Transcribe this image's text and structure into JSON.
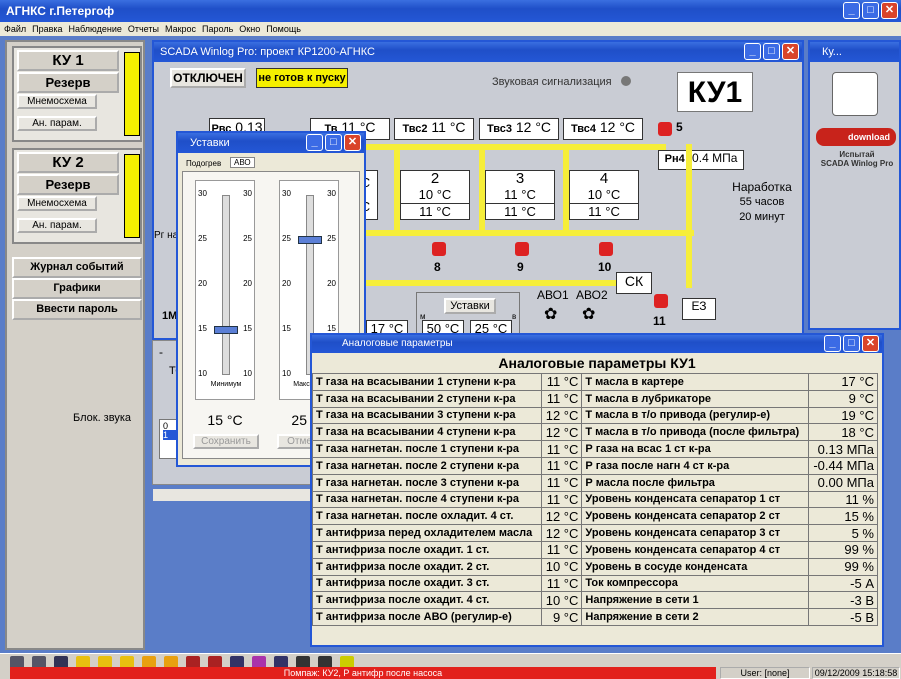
{
  "app_title": "АГНКС г.Петергоф",
  "menu": [
    "Файл",
    "Правка",
    "Наблюдение",
    "Отчеты",
    "Макрос",
    "Пароль",
    "Окно",
    "Помощь"
  ],
  "ku1": {
    "title": "КУ 1",
    "mode": "Резерв",
    "btn_mnemo": "Мнемосхема",
    "btn_an": "Ан. парам."
  },
  "ku2": {
    "title": "КУ 2",
    "mode": "Резерв",
    "btn_mnemo": "Мнемосхема",
    "btn_an": "Ан. парам."
  },
  "left_buttons": {
    "journal": "Журнал событий",
    "graphs": "Графики",
    "password": "Ввести пароль",
    "sound": "Блок. звука"
  },
  "scada": {
    "title": "SCADA Winlog Pro: проект КР1200-АГНКС",
    "status_off": "ОТКЛЮЧЕН",
    "status_ready": "не готов к пуску",
    "sound": "Звуковая сигнализация",
    "unit": "КУ1",
    "rvs_label": "Рвс",
    "rvs_value": "0.13 МПа",
    "tv_label": "Тв",
    "tv_value": "11 °С",
    "tvs2_label": "Твс2",
    "tvs2_value": "11 °С",
    "tvs3_label": "Твс3",
    "tvs3_value": "12 °С",
    "tvs4_label": "Твс4",
    "tvs4_value": "12 °С",
    "rn4_label": "Рн4",
    "rn4_value": "-0.4 МПа",
    "valve5": "5",
    "stages": [
      {
        "n": "2",
        "a": "10 °С",
        "b": "11 °С",
        "valve": "9"
      },
      {
        "n": "3",
        "a": "11 °С",
        "b": "11 °С",
        "valve": "9"
      },
      {
        "n": "4",
        "a": "10 °С",
        "b": "11 °С",
        "valve": "10"
      }
    ],
    "valve8": "8",
    "valve9": "9",
    "valve10": "10",
    "valve11": "11",
    "hours_label": "Наработка",
    "hours": "55 часов",
    "minutes": "20 минут",
    "sk": "СК",
    "e3": "ЕЗ",
    "avo1": "АВО1",
    "avo2": "АВО2",
    "ustavki": "Уставки",
    "m": "м",
    "v": "в",
    "t_m": "50 °С",
    "t_v": "25 °С",
    "t_left": "17 °С",
    "rg": "Рг на",
    "one_m": "1М",
    "to": "ТО",
    "c1": "С",
    "c2": "С",
    "minus": "-"
  },
  "ky_window": {
    "title": "Ку...",
    "download": "download",
    "trial": "Испытай",
    "trial2": "SCADA Winlog Pro"
  },
  "ustavki_window": {
    "title": "Уставки",
    "tab1": "Подогрев",
    "tab2": "АВО",
    "slider_min_label": "Минимум",
    "slider_max_label": "Максимум",
    "min_value": "15 °С",
    "max_value": "25 °С",
    "save": "Сохранить",
    "cancel": "Отменить",
    "ticks": [
      "30",
      "25",
      "20",
      "15",
      "10"
    ],
    "min_level": 15,
    "max_level": 25
  },
  "analog": {
    "window_title": "Аналоговые параметры",
    "heading": "Аналоговые параметры КУ1",
    "rows": [
      [
        "Т газа на всасывании 1 ступени к-ра",
        "11 °С",
        "Т масла в картере",
        "17 °С"
      ],
      [
        "Т газа на всасывании 2 ступени к-ра",
        "11 °С",
        "Т масла в лубрикаторе",
        "9 °С"
      ],
      [
        "Т газа на всасывании 3 ступени к-ра",
        "12 °С",
        "Т масла в т/о привода (регулир-е)",
        "19 °С"
      ],
      [
        "Т газа на всасывании 4 ступени к-ра",
        "12 °С",
        "Т масла в т/о привода (после фильтра)",
        "18 °С"
      ],
      [
        "Т газа нагнетан. после 1 ступени к-ра",
        "11 °С",
        "Р газа на всас 1 ст к-ра",
        "0.13 МПа"
      ],
      [
        "Т газа нагнетан. после 2 ступени к-ра",
        "11 °С",
        "Р газа после нагн 4 ст к-ра",
        "-0.44 МПа"
      ],
      [
        "Т газа нагнетан. после 3 ступени к-ра",
        "11 °С",
        "Р масла после фильтра",
        "0.00 МПа"
      ],
      [
        "Т газа нагнетан. после 4 ступени к-ра",
        "11 °С",
        "Уровень конденсата сепаратор 1 ст",
        "11 %"
      ],
      [
        "Т газа нагнетан. после охладит. 4 ст.",
        "12 °С",
        "Уровень конденсата сепаратор 2 ст",
        "15 %"
      ],
      [
        "Т антифриза перед охладителем масла",
        "12 °С",
        "Уровень конденсата сепаратор 3 ст",
        "5 %"
      ],
      [
        "Т антифриза после охадит. 1 ст.",
        "11 °С",
        "Уровень конденсата сепаратор 4 ст",
        "99 %"
      ],
      [
        "Т антифриза после охадит. 2 ст.",
        "10 °С",
        "Уровень в сосуде конденсата",
        "99 %"
      ],
      [
        "Т антифриза после охадит. 3 ст.",
        "11 °С",
        "Ток компрессора",
        "-5 А"
      ],
      [
        "Т антифриза после охадит. 4 ст.",
        "10 °С",
        "Напряжение в сети 1",
        "-3 В"
      ],
      [
        "Т антифриза после АВО (регулир-е)",
        "9 °С",
        "Напряжение в сети 2",
        "-5 В"
      ]
    ]
  },
  "status": {
    "message": "Помпаж: КУ2, Р антифр после насоса",
    "user": "User: [none]",
    "datetime": "09/12/2009 15:18:58"
  },
  "grid": {
    "c0": "0",
    "c1": "1"
  }
}
